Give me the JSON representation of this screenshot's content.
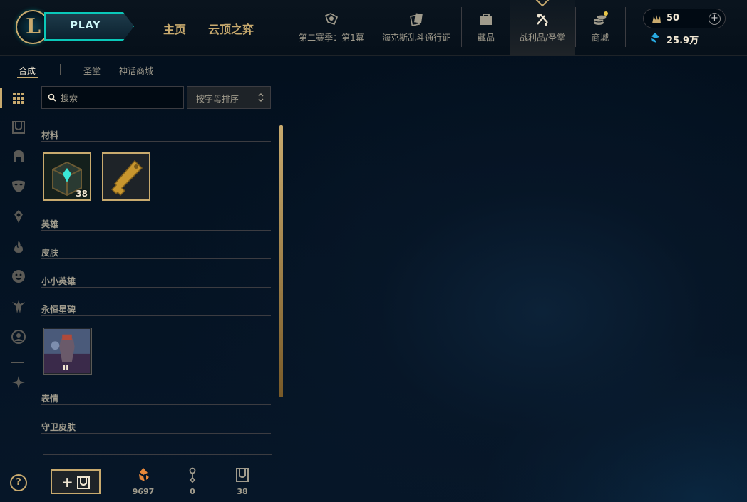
{
  "topbar": {
    "logo_letter": "L",
    "play_label": "PLAY",
    "main_nav": [
      "主页",
      "云顶之弈"
    ],
    "nav_items": [
      {
        "label": "第二赛季：第1幕",
        "icon": "season-pass-icon"
      },
      {
        "label": "海克斯乱斗通行证",
        "icon": "cards-icon"
      },
      {
        "label": "藏品",
        "icon": "collection-icon"
      },
      {
        "label": "战利品/圣堂",
        "icon": "loot-icon",
        "active": true
      },
      {
        "label": "商城",
        "icon": "store-coins-icon"
      }
    ],
    "rp_value": "50",
    "plus_label": "+",
    "be_value": "25.9万"
  },
  "subtabs": {
    "items": [
      "合成",
      "圣堂",
      "神话商城"
    ],
    "active": "合成"
  },
  "filters": {
    "search_placeholder": "搜索",
    "search_value": "",
    "sort_label": "按字母排序"
  },
  "categories": {
    "materials": "材料",
    "champions": "英雄",
    "skins": "皮肤",
    "little_legends": "小小英雄",
    "eternals": "永恒星碑",
    "emotes": "表情",
    "ward_skins": "守卫皮肤"
  },
  "materials_items": [
    {
      "name": "hextech-chest",
      "count": "38"
    },
    {
      "name": "key",
      "count": ""
    }
  ],
  "eternals_items": [
    {
      "name": "eternal-series",
      "roman": "II"
    }
  ],
  "footer": {
    "help_label": "?",
    "craft_plus": "+",
    "orange_essence": "9697",
    "keys": "0",
    "chests": "38"
  },
  "colors": {
    "gold": "#c8aa6e",
    "teal": "#0ac8b9",
    "text": "#a09b8c",
    "bright": "#f0e6d2",
    "orange_essence": "#e8883a",
    "blue_essence": "#28a9e0"
  }
}
